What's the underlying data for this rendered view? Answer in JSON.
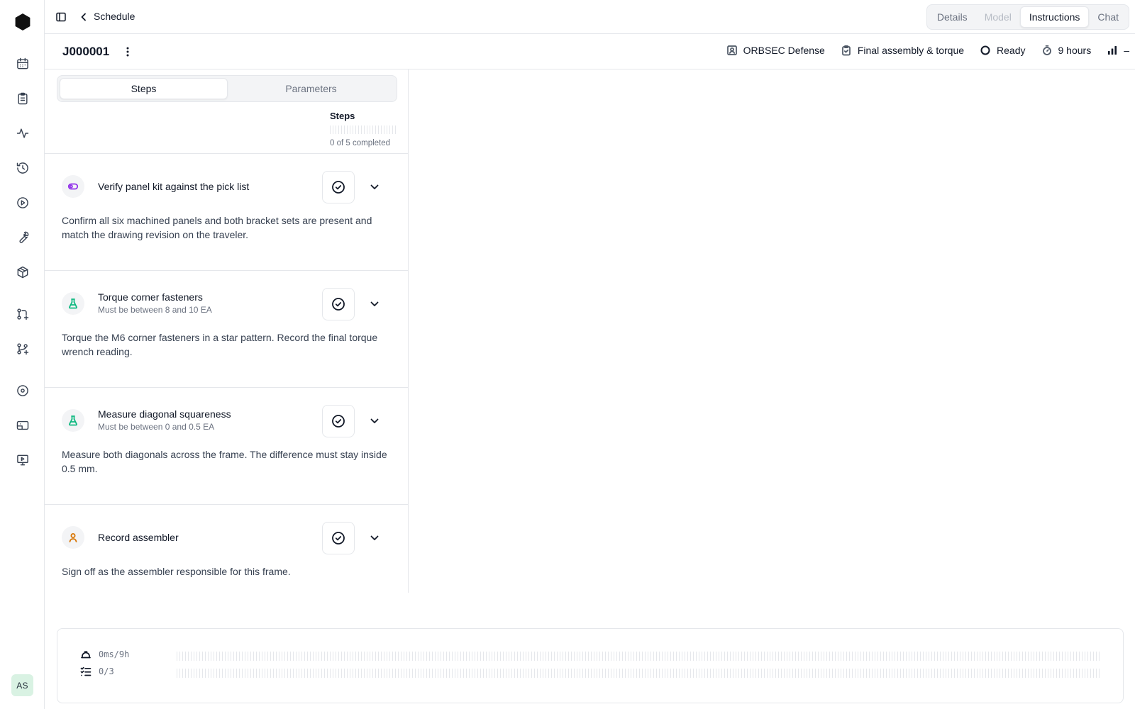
{
  "app": {
    "breadcrumb": "Schedule",
    "user_initials": "AS"
  },
  "view_tabs": [
    {
      "label": "Details",
      "state": "normal"
    },
    {
      "label": "Model",
      "state": "disabled"
    },
    {
      "label": "Instructions",
      "state": "active"
    },
    {
      "label": "Chat",
      "state": "normal"
    }
  ],
  "job": {
    "id": "J000001",
    "customer": "ORBSEC Defense",
    "operation": "Final assembly & torque",
    "status": "Ready",
    "duration": "9 hours",
    "priority": "–"
  },
  "panel_tabs": [
    {
      "label": "Steps",
      "active": true
    },
    {
      "label": "Parameters",
      "active": false
    }
  ],
  "progress": {
    "title": "Steps",
    "summary": "0 of 5 completed",
    "completed": 0,
    "total": 5
  },
  "steps": [
    {
      "title": "Verify panel kit against the pick list",
      "subtitle": "",
      "icon": "toggle-icon",
      "icon_color": "#9333ea",
      "description": "Confirm all six machined panels and both bracket sets are present and match the drawing revision on the traveler."
    },
    {
      "title": "Torque corner fasteners",
      "subtitle": "Must be between 8 and 10 EA",
      "icon": "flask-icon",
      "icon_color": "#10b981",
      "description": "Torque the M6 corner fasteners in a star pattern. Record the final torque wrench reading."
    },
    {
      "title": "Measure diagonal squareness",
      "subtitle": "Must be between 0 and 0.5 EA",
      "icon": "flask-icon",
      "icon_color": "#10b981",
      "description": "Measure both diagonals across the frame. The difference must stay inside 0.5 mm."
    },
    {
      "title": "Record assembler",
      "subtitle": "",
      "icon": "user-icon",
      "icon_color": "#d97706",
      "description": "Sign off as the assembler responsible for this frame."
    }
  ],
  "timeline": {
    "time_label": "0ms/9h",
    "tasks_label": "0/3"
  },
  "colors": {
    "border": "#e5e7eb",
    "active_tab_bg": "#ffffff",
    "avatar_bg": "#d9f2e3"
  }
}
